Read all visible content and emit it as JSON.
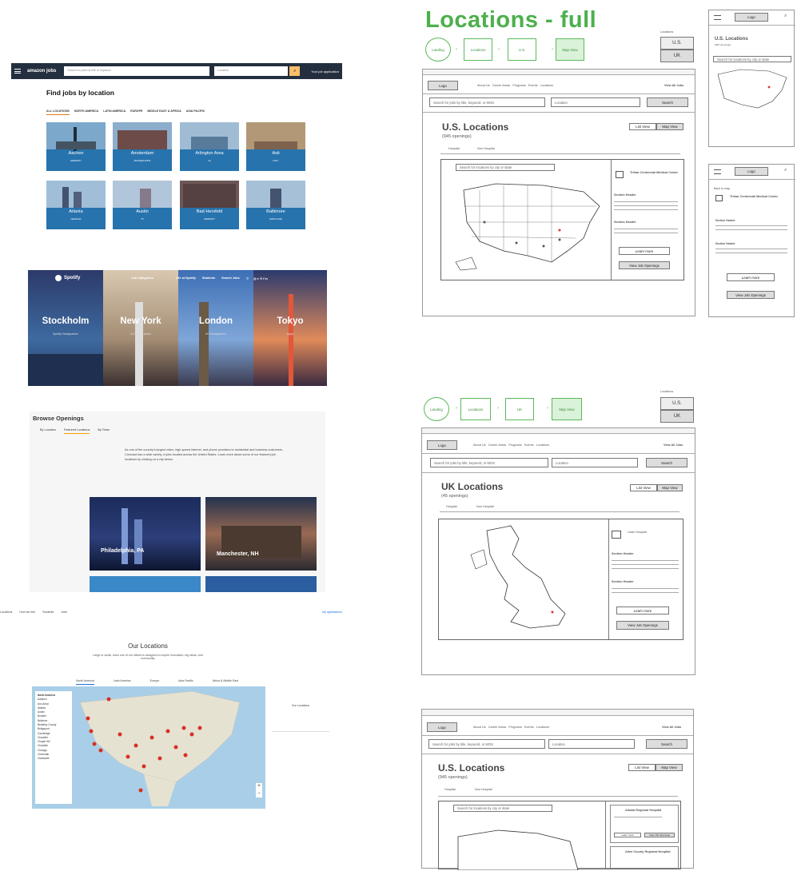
{
  "amazon": {
    "logo": "amazon jobs",
    "search_placeholder": "Search for jobs by title or keyword",
    "location_placeholder": "Location",
    "apps": "Your job application",
    "title": "Find jobs by location",
    "tabs": [
      "ALL LOCATIONS",
      "NORTH AMERICA",
      "LATIN AMERICA",
      "EUROPE",
      "MIDDLE EAST & AFRICA",
      "ASIA PACIFIC"
    ],
    "cities": [
      {
        "name": "Aachen",
        "country": "GERMANY"
      },
      {
        "name": "Amsterdam",
        "country": "NETHERLANDS"
      },
      {
        "name": "Arlington Area",
        "country": "VA"
      },
      {
        "name": "Asti",
        "country": "ITALY"
      },
      {
        "name": "Atlanta",
        "country": "GEORGIA"
      },
      {
        "name": "Austin",
        "country": "TX"
      },
      {
        "name": "Bad Hersfeld",
        "country": "GERMANY"
      },
      {
        "name": "Baltimore",
        "country": "MARYLAND"
      }
    ]
  },
  "spotify": {
    "logo": "Spotify",
    "nav": [
      "Job Categories",
      "Life at Spotify",
      "Students",
      "Search Jobs"
    ],
    "cities": [
      {
        "name": "Stockholm",
        "sub": "Spotify Headquarters"
      },
      {
        "name": "New York",
        "sub": "US Headquarters"
      },
      {
        "name": "London",
        "sub": "UK Headquarters"
      },
      {
        "name": "Tokyo",
        "sub": "Japan"
      }
    ]
  },
  "comcast": {
    "title": "Browse Openings",
    "tabs": [
      "By Location",
      "Featured Locations",
      "By Team"
    ],
    "text": "As one of the country's largest video, high-speed internet, and phone providers to residential and business customers, Comcast has a wide variety of jobs located across the United States. Learn more about some of our featured job locations by clicking on a city below.",
    "cities": [
      "Philadelphia, PA",
      "Manchester, NH"
    ]
  },
  "google": {
    "nav": [
      "Locations",
      "How we hire",
      "Students",
      "Jobs"
    ],
    "apps": "My applications",
    "title": "Our Locations",
    "sub": "Large or small, each one of our offices is designed to inspire innovation, big ideas, and community.",
    "regions": [
      "North America",
      "Latin America",
      "Europe",
      "Asia Pacific",
      "Africa & Middle East"
    ],
    "list_title": "North America",
    "list": [
      "Addison",
      "Ann Arbor",
      "Atlanta",
      "Austin",
      "Boulder",
      "Bellevue",
      "Berkeley County",
      "Bridgeport",
      "Cambridge",
      "Chandler",
      "Chapel Hill",
      "Charlotte",
      "Chicago",
      "Cincinnati",
      "Clarksville"
    ],
    "right_title": "Our Locations"
  },
  "wire": {
    "title": "Locations - full",
    "flow1": [
      "Landing",
      "Locations",
      "U.S.",
      "Map View"
    ],
    "flow2": [
      "Landing",
      "Locations",
      "UK",
      "Map View"
    ],
    "loc_label": "Locations",
    "opts": [
      "U.S.",
      "UK"
    ],
    "logo": "Logo",
    "nav": [
      "About Us",
      "Career Areas",
      "Programs",
      "Events",
      "Locations"
    ],
    "view_all": "View All Jobs",
    "search": "Search for jobs by title, keyword, or MOS",
    "location": "Location",
    "search_btn": "Search",
    "us_title": "U.S. Locations",
    "us_count": "(945 openings)",
    "uk_title": "UK Locations",
    "uk_count": "(45 openings)",
    "tabs": [
      "Hospital",
      "Non Hospital"
    ],
    "list_view": "List View",
    "map_view": "Map View",
    "map_search": "Search for locations by city or state",
    "hosp_us": "Trilnar Centennial Medical Center",
    "hosp_uk": "Lister Hospital",
    "section": "Section Header",
    "learn": "Learn more",
    "openings": "View Job Openings",
    "back": "Back to map",
    "hosp_a": "Alaska Regional Hospital",
    "hosp_b": "Allen County Regional Hospital"
  }
}
